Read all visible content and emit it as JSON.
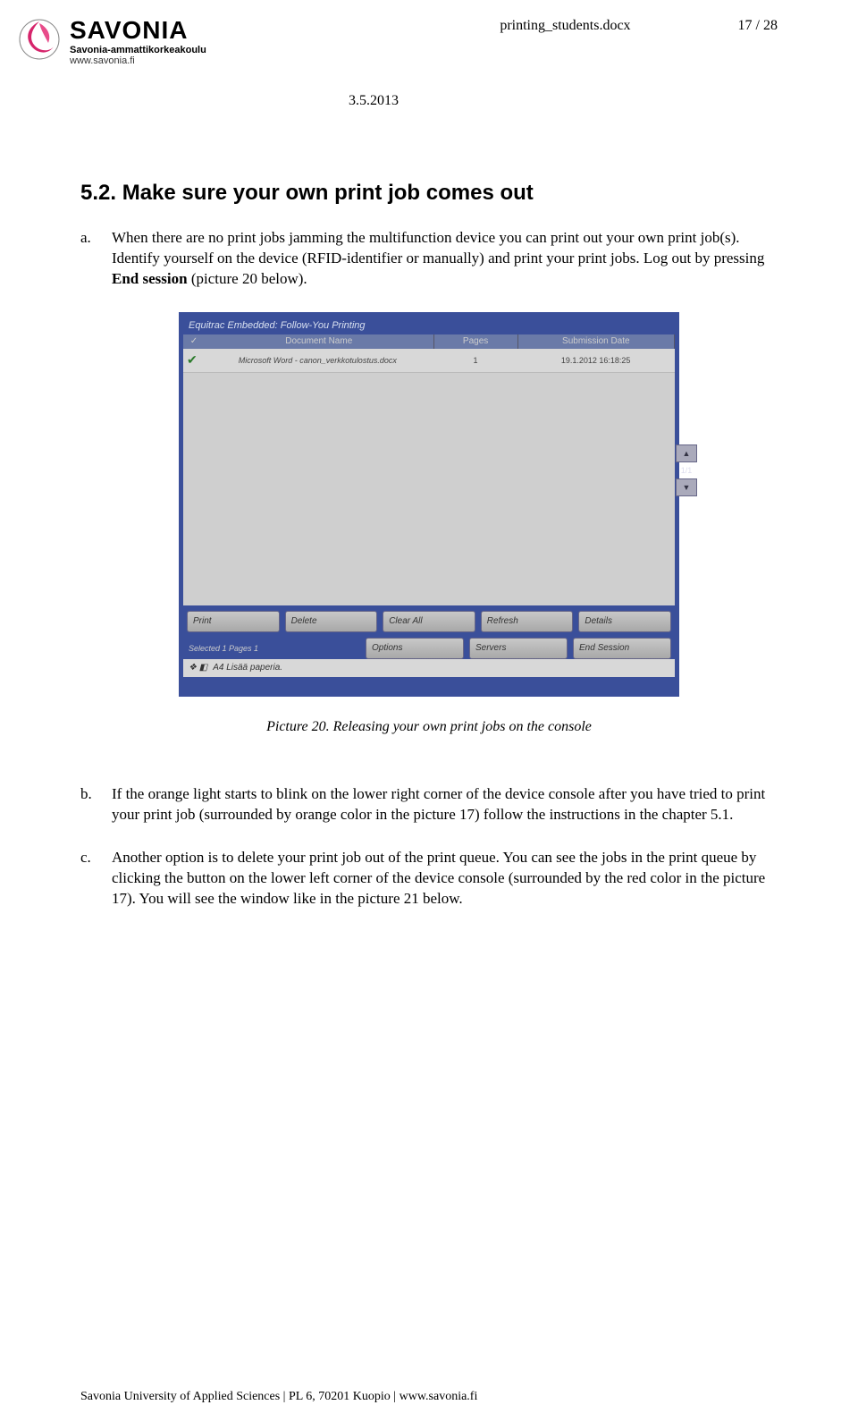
{
  "header": {
    "logo_main": "SAVONIA",
    "logo_sub1": "Savonia-ammattikorkeakoulu",
    "logo_sub2": "www.savonia.fi",
    "doc_name": "printing_students.docx",
    "page_indicator": "17 / 28",
    "date": "3.5.2013"
  },
  "section_title": "5.2. Make sure your own print job comes out",
  "paragraphs": {
    "a": "When there are no print jobs jamming the multifunction device you can print out your own print job(s). Identify yourself on the device (RFID-identifier or manually) and print your print jobs. Log out by pressing End session (picture 20 below).",
    "b": "If the orange light starts to blink on the lower right corner of the device console after you have tried to print your print job (surrounded by orange color in the picture 17) follow the instructions in the chapter 5.1.",
    "c": "Another option is to delete your print job out of the print queue. You can see the jobs in the print queue by clicking the button on the lower left corner of the device console (surrounded by the red color in the picture 17). You will see the window like in the picture 21 below."
  },
  "caption": "Picture 20. Releasing your own print jobs on the console",
  "screenshot": {
    "title": "Equitrac Embedded: Follow-You Printing",
    "cols": {
      "c1": "Document Name",
      "c2": "Pages",
      "c3": "Submission Date"
    },
    "row": {
      "name": "Microsoft Word - canon_verkkotulostus.docx",
      "pages": "1",
      "date": "19.1.2012 16:18:25"
    },
    "pager": "1/1",
    "buttons": {
      "print": "Print",
      "delete": "Delete",
      "clearall": "Clear All",
      "refresh": "Refresh",
      "details": "Details",
      "options": "Options",
      "servers": "Servers",
      "endsession": "End Session"
    },
    "selected": "Selected 1 Pages 1",
    "footer": "A4  Lisää paperia."
  },
  "footer": "Savonia University of Applied Sciences | PL 6, 70201 Kuopio | www.savonia.fi"
}
